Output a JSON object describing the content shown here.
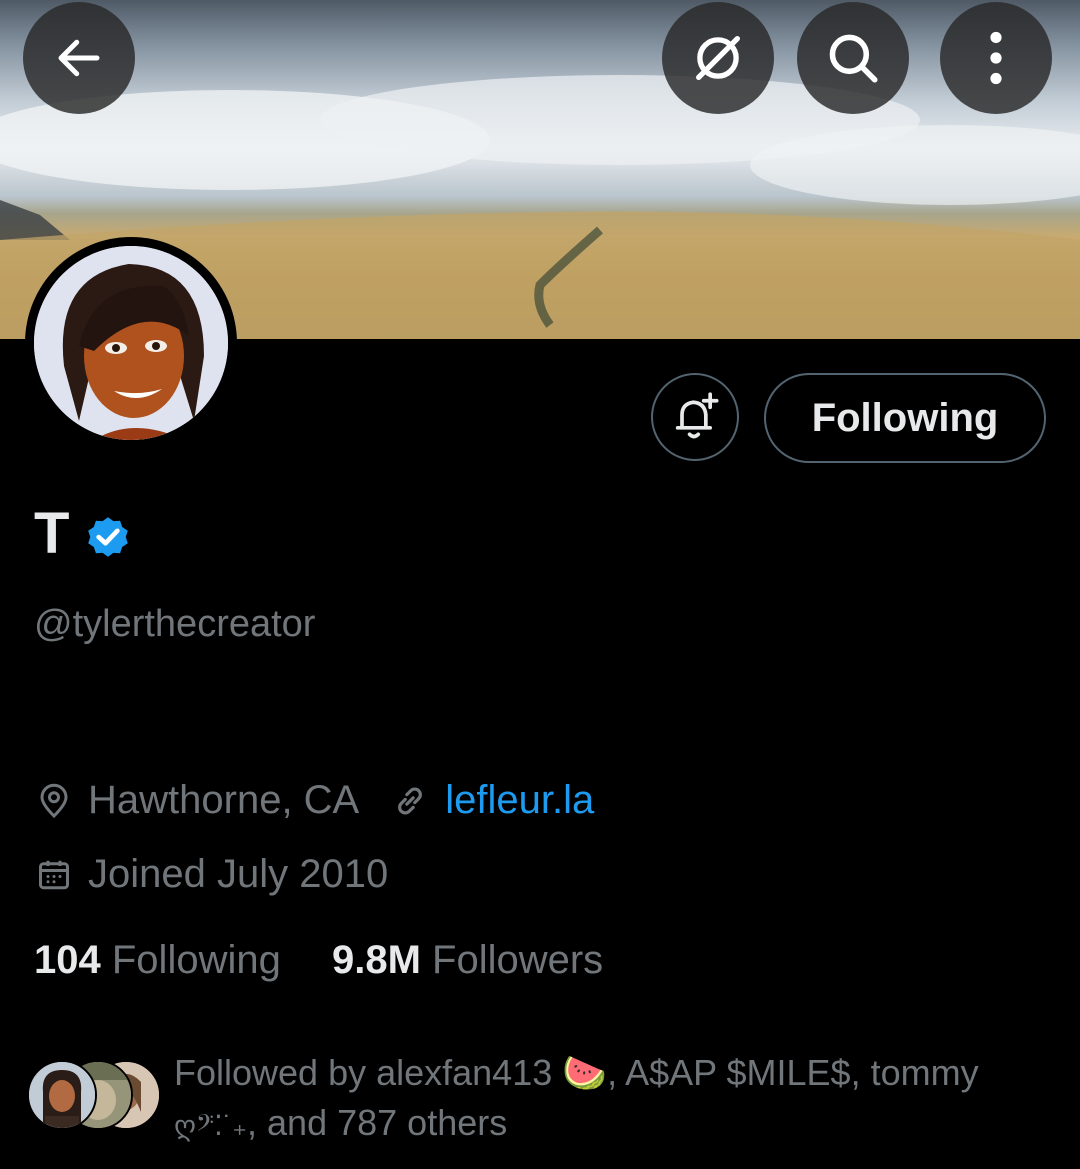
{
  "header": {
    "back_icon": "arrow-left-icon",
    "grok_icon": "grok-icon",
    "search_icon": "search-icon",
    "more_icon": "more-vertical-icon"
  },
  "actions": {
    "notify_icon": "bell-plus-icon",
    "following_label": "Following"
  },
  "profile": {
    "display_name": "T",
    "handle": "@tylerthecreator",
    "location": "Hawthorne, CA",
    "website": "lefleur.la",
    "joined": "Joined July 2010",
    "verified_color": "#1d9bf0"
  },
  "stats": {
    "following_count": "104",
    "following_label": "Following",
    "followers_count": "9.8M",
    "followers_label": "Followers"
  },
  "followed_by": {
    "prefix": "Followed by alexfan413 ",
    "emoji1": "🍉",
    "middle": ", A$AP $MILE$, tommy",
    "emoji2": "ღ𝄢⁚˙₊",
    "suffix": ", and 787 others"
  },
  "colors": {
    "background": "#000000",
    "muted_text": "#71767b",
    "link": "#1d9bf0"
  }
}
